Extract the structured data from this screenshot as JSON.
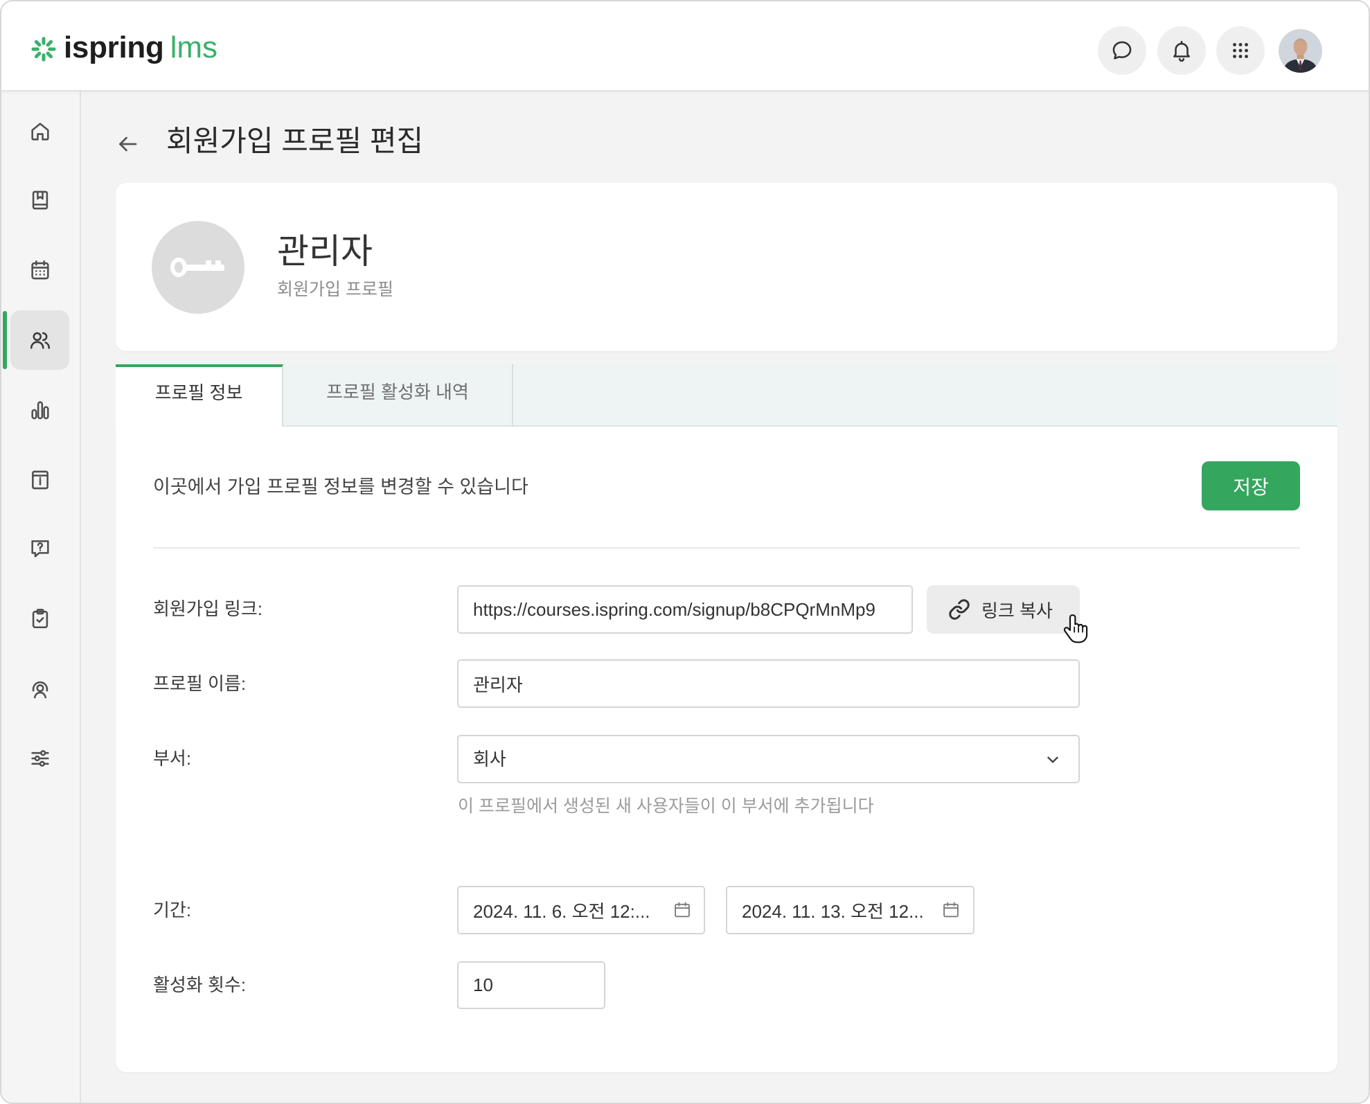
{
  "colors": {
    "accent": "#35a65e",
    "logo_green": "#3ab16a"
  },
  "logo": {
    "icon": "ispring-logo-icon",
    "brand": "ispring",
    "product": "lms"
  },
  "header": {
    "actions": [
      {
        "icon": "chat-icon"
      },
      {
        "icon": "bell-icon"
      },
      {
        "icon": "apps-grid-icon"
      },
      {
        "icon": "user-avatar"
      }
    ]
  },
  "sidebar": {
    "active_index": 3,
    "items": [
      {
        "icon": "home-icon"
      },
      {
        "icon": "book-icon"
      },
      {
        "icon": "calendar-icon"
      },
      {
        "icon": "users-icon"
      },
      {
        "icon": "bar-chart-icon"
      },
      {
        "icon": "info-card-icon"
      },
      {
        "icon": "question-chat-icon"
      },
      {
        "icon": "clipboard-check-icon"
      },
      {
        "icon": "support-agent-icon"
      },
      {
        "icon": "settings-sliders-icon"
      }
    ]
  },
  "page": {
    "back_icon": "arrow-left-icon",
    "title": "회원가입 프로필 편집"
  },
  "profile_card": {
    "avatar_icon": "key-icon",
    "name": "관리자",
    "subtitle": "회원가입 프로필"
  },
  "tabs": [
    {
      "label": "프로필 정보",
      "active": true
    },
    {
      "label": "프로필 활성화 내역",
      "active": false
    }
  ],
  "form": {
    "intro": "이곳에서 가입 프로필 정보를 변경할 수 있습니다",
    "save_label": "저장",
    "signup_link": {
      "label": "회원가입 링크:",
      "value": "https://courses.ispring.com/signup/b8CPQrMnMp9",
      "copy_icon": "link-icon",
      "copy_label": "링크 복사"
    },
    "profile_name": {
      "label": "프로필 이름:",
      "value": "관리자"
    },
    "department": {
      "label": "부서:",
      "value": "회사",
      "hint": "이 프로필에서 생성된 새 사용자들이 이 부서에 추가됩니다"
    },
    "period": {
      "label": "기간:",
      "start": "2024. 11. 6. 오전 12:...",
      "end": "2024. 11. 13. 오전 12..."
    },
    "activation_count": {
      "label": "활성화 횟수:",
      "value": "10"
    }
  }
}
